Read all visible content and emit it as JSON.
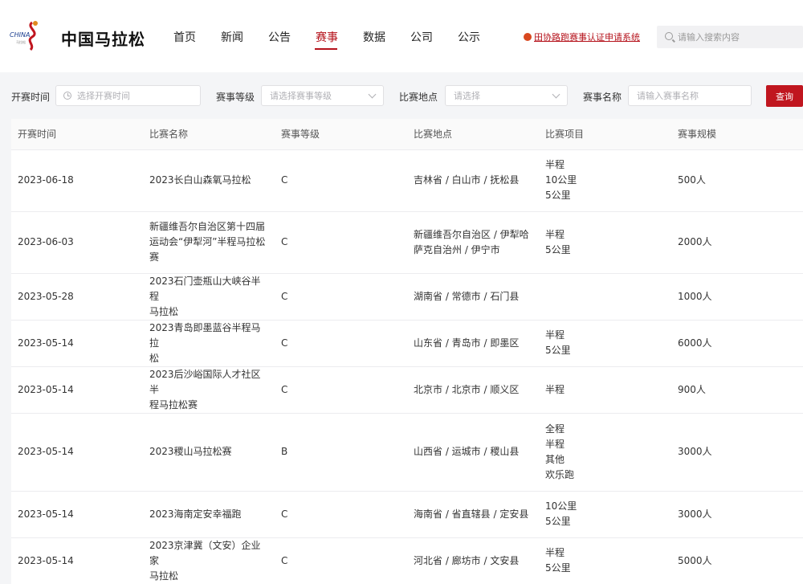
{
  "header": {
    "site_title": "中国马拉松",
    "nav": [
      {
        "label": "首页",
        "active": false
      },
      {
        "label": "新闻",
        "active": false
      },
      {
        "label": "公告",
        "active": false
      },
      {
        "label": "赛事",
        "active": true
      },
      {
        "label": "数据",
        "active": false
      },
      {
        "label": "公司",
        "active": false
      },
      {
        "label": "公示",
        "active": false
      }
    ],
    "cert_link": "田协路跑赛事认证申请系统",
    "search_placeholder": "请输入搜索内容",
    "accent_color": "#b5121b"
  },
  "filters": {
    "start_time_label": "开赛时间",
    "start_time_placeholder": "选择开赛时间",
    "level_label": "赛事等级",
    "level_placeholder": "请选择赛事等级",
    "location_label": "比赛地点",
    "location_placeholder": "请选择",
    "name_label": "赛事名称",
    "name_placeholder": "请输入赛事名称",
    "query_label": "查询"
  },
  "table": {
    "columns": [
      "开赛时间",
      "比赛名称",
      "赛事等级",
      "比赛地点",
      "比赛项目",
      "赛事规模"
    ],
    "rows": [
      {
        "date": "2023-06-18",
        "name": [
          "2023长白山森氧马拉松"
        ],
        "level": "C",
        "location": [
          "吉林省 / 白山市 / 抚松县"
        ],
        "events": [
          "半程",
          "10公里",
          "5公里"
        ],
        "scale": "500人"
      },
      {
        "date": "2023-06-03",
        "name": [
          "新疆维吾尔自治区第十四届",
          "运动会“伊犁河”半程马拉松",
          "赛"
        ],
        "level": "C",
        "location": [
          "新疆维吾尔自治区 / 伊犁哈",
          "萨克自治州 / 伊宁市"
        ],
        "events": [
          "半程",
          "5公里"
        ],
        "scale": "2000人"
      },
      {
        "date": "2023-05-28",
        "name": [
          "2023石门壶瓶山大峡谷半程",
          "马拉松"
        ],
        "level": "C",
        "location": [
          "湖南省 / 常德市 / 石门县"
        ],
        "events": [],
        "scale": "1000人"
      },
      {
        "date": "2023-05-14",
        "name": [
          "2023青岛即墨蓝谷半程马拉",
          "松"
        ],
        "level": "C",
        "location": [
          "山东省 / 青岛市 / 即墨区"
        ],
        "events": [
          "半程",
          "5公里"
        ],
        "scale": "6000人"
      },
      {
        "date": "2023-05-14",
        "name": [
          "2023后沙峪国际人才社区半",
          "程马拉松赛"
        ],
        "level": "C",
        "location": [
          "北京市 / 北京市 / 顺义区"
        ],
        "events": [
          "半程"
        ],
        "scale": "900人"
      },
      {
        "date": "2023-05-14",
        "name": [
          "2023稷山马拉松赛"
        ],
        "level": "B",
        "location": [
          "山西省 / 运城市 / 稷山县"
        ],
        "events": [
          "全程",
          "半程",
          "其他",
          "欢乐跑"
        ],
        "scale": "3000人"
      },
      {
        "date": "2023-05-14",
        "name": [
          "2023海南定安幸福跑"
        ],
        "level": "C",
        "location": [
          "海南省 / 省直辖县 / 定安县"
        ],
        "events": [
          "10公里",
          "5公里"
        ],
        "scale": "3000人"
      },
      {
        "date": "2023-05-14",
        "name": [
          "2023京津冀（文安）企业家",
          "马拉松"
        ],
        "level": "C",
        "location": [
          "河北省 / 廊坊市 / 文安县"
        ],
        "events": [
          "半程",
          "5公里"
        ],
        "scale": "5000人"
      }
    ]
  }
}
